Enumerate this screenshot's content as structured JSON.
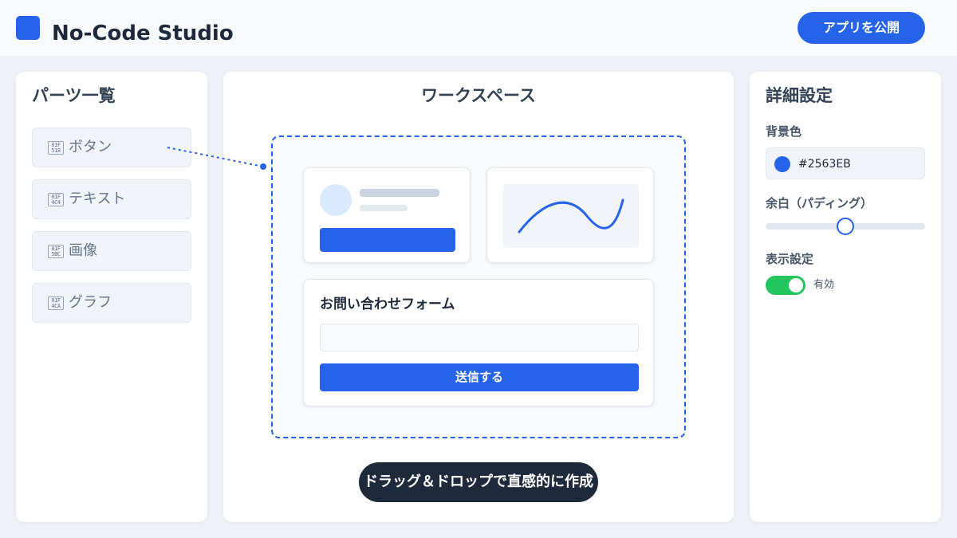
{
  "app": {
    "title": "No-Code Studio",
    "publish_label": "アプリを公開",
    "accent_color": "#2563EB"
  },
  "parts_panel": {
    "title": "パーツ一覧",
    "items": [
      {
        "label": "ボタン",
        "icon": "button-icon",
        "glyph": "01F 518"
      },
      {
        "label": "テキスト",
        "icon": "text-icon",
        "glyph": "01F 4C4"
      },
      {
        "label": "画像",
        "icon": "image-icon",
        "glyph": "01F 5BC"
      },
      {
        "label": "グラフ",
        "icon": "chart-icon",
        "glyph": "01F 4CA"
      }
    ]
  },
  "workspace": {
    "title": "ワークスペース",
    "form_title": "お問い合わせフォーム",
    "submit_label": "送信する",
    "hint": "ドラッグ＆ドロップで直感的に作成"
  },
  "properties": {
    "title": "詳細設定",
    "background_label": "背景色",
    "background_value": "#2563EB",
    "padding_label": "余白（パディング）",
    "padding_level": 0.5,
    "display_label": "表示設定",
    "display_toggle_label": "有効",
    "display_enabled": true,
    "toggle_on_color": "#22C55E"
  }
}
